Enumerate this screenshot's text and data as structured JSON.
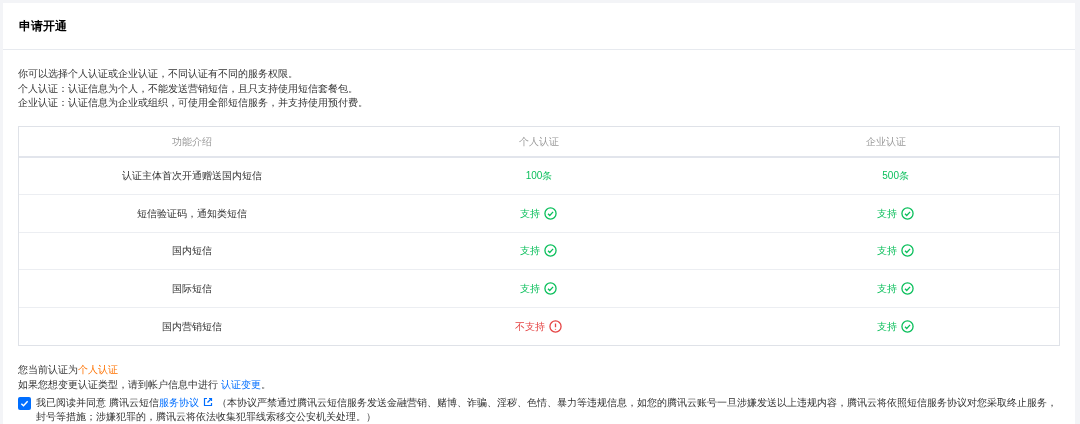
{
  "title": "申请开通",
  "intro": [
    "你可以选择个人认证或企业认证，不同认证有不同的服务权限。",
    "个人认证：认证信息为个人，不能发送营销短信，且只支持使用短信套餐包。",
    "企业认证：认证信息为企业或组织，可使用全部短信服务，并支持使用预付费。"
  ],
  "table": {
    "columns": [
      "功能介绍",
      "个人认证",
      "企业认证"
    ],
    "rows": [
      {
        "feature": "认证主体首次开通赠送国内短信",
        "personal": {
          "kind": "text",
          "text": "100条"
        },
        "enterprise": {
          "kind": "text",
          "text": "500条"
        }
      },
      {
        "feature": "短信验证码，通知类短信",
        "personal": {
          "kind": "yes",
          "text": "支持"
        },
        "enterprise": {
          "kind": "yes",
          "text": "支持"
        }
      },
      {
        "feature": "国内短信",
        "personal": {
          "kind": "yes",
          "text": "支持"
        },
        "enterprise": {
          "kind": "yes",
          "text": "支持"
        }
      },
      {
        "feature": "国际短信",
        "personal": {
          "kind": "yes",
          "text": "支持"
        },
        "enterprise": {
          "kind": "yes",
          "text": "支持"
        }
      },
      {
        "feature": "国内营销短信",
        "personal": {
          "kind": "no",
          "text": "不支持"
        },
        "enterprise": {
          "kind": "yes",
          "text": "支持"
        }
      }
    ]
  },
  "current": {
    "label": "您当前认证为",
    "value": "个人认证"
  },
  "change": {
    "text": "如果您想变更认证类型，请到帐户信息中进行 ",
    "link": "认证变更",
    "suffix": "。"
  },
  "agreement": {
    "checked": true,
    "prefix": "我已阅读并同意 腾讯云短信",
    "link": "服务协议",
    "text": "（本协议严禁通过腾讯云短信服务发送金融营销、赌博、诈骗、淫秽、色情、暴力等违规信息，如您的腾讯云账号一旦涉嫌发送以上违规内容，腾讯云将依照短信服务协议对您采取终止服务，封号等措施；涉嫌犯罪的，腾讯云将依法收集犯罪线索移交公安机关处理。）"
  }
}
